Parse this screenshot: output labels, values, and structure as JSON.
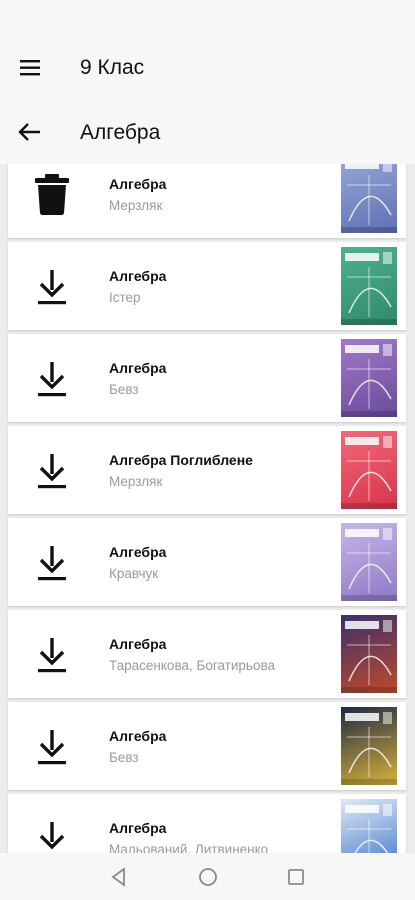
{
  "header": {
    "title": "9 Клас",
    "menu_icon": "hamburger-menu-icon"
  },
  "subheader": {
    "title": "Алгебра",
    "back_icon": "arrow-back-icon"
  },
  "books": [
    {
      "title": "Алгебра",
      "author": "Мерзляк",
      "action": "delete",
      "action_icon": "trash-icon",
      "cover_icon": "book-cover-thumbnail",
      "cover_colors": [
        "#9aa9d6",
        "#5e6fb5"
      ]
    },
    {
      "title": "Алгебра",
      "author": "Істер",
      "action": "download",
      "action_icon": "download-icon",
      "cover_icon": "book-cover-thumbnail",
      "cover_colors": [
        "#4fb08f",
        "#2f8a6a"
      ]
    },
    {
      "title": "Алгебра",
      "author": "Бевз",
      "action": "download",
      "action_icon": "download-icon",
      "cover_icon": "book-cover-thumbnail",
      "cover_colors": [
        "#a07ac8",
        "#6b4a9c"
      ]
    },
    {
      "title": "Алгебра Поглиблене",
      "author": "Мерзляк",
      "action": "download",
      "action_icon": "download-icon",
      "cover_icon": "book-cover-thumbnail",
      "cover_colors": [
        "#f06a7a",
        "#d8344a"
      ]
    },
    {
      "title": "Алгебра",
      "author": "Кравчук",
      "action": "download",
      "action_icon": "download-icon",
      "cover_icon": "book-cover-thumbnail",
      "cover_colors": [
        "#c6b7e6",
        "#8d79c6"
      ]
    },
    {
      "title": "Алгебра",
      "author": "Тарасенкова, Богатирьова",
      "action": "download",
      "action_icon": "download-icon",
      "cover_icon": "book-cover-thumbnail",
      "cover_colors": [
        "#3a2f6e",
        "#c04a2a"
      ]
    },
    {
      "title": "Алгебра",
      "author": "Бевз",
      "action": "download",
      "action_icon": "download-icon",
      "cover_icon": "book-cover-thumbnail",
      "cover_colors": [
        "#1e2a44",
        "#d8b23a"
      ]
    },
    {
      "title": "Алгебра",
      "author": "Мальований, Литвиненко",
      "action": "download",
      "action_icon": "download-icon",
      "cover_icon": "book-cover-thumbnail",
      "cover_colors": [
        "#dfe8f5",
        "#3a72c8"
      ]
    }
  ],
  "navbar": {
    "back_icon": "nav-back-triangle-icon",
    "home_icon": "nav-home-circle-icon",
    "recents_icon": "nav-recents-square-icon"
  }
}
